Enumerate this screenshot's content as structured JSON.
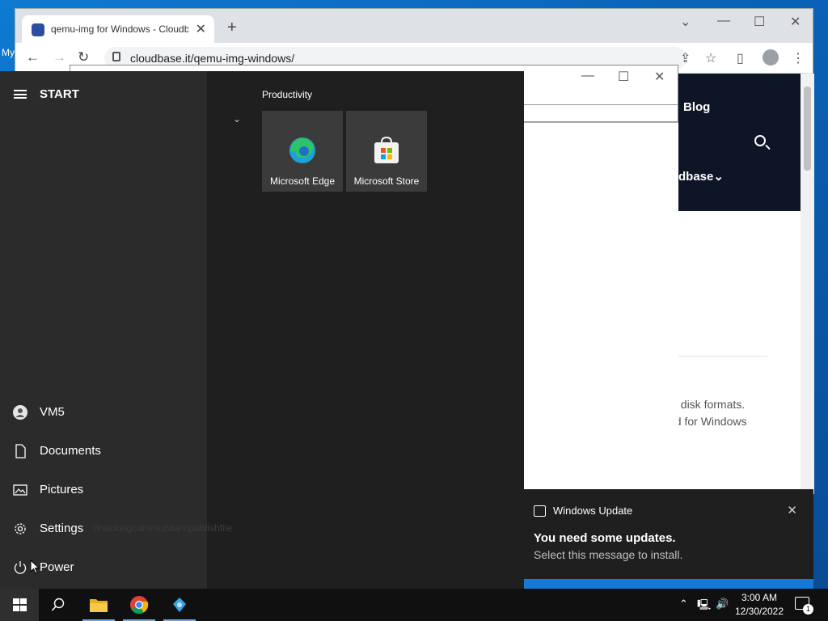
{
  "desktop": {
    "label": "My"
  },
  "browser": {
    "tab_title": "qemu-img for Windows - Cloudbase Solutions",
    "tab_close": "✕",
    "new_tab": "+",
    "url": "cloudbase.it/qemu-img-windows/",
    "page": {
      "nav_blog": "Blog",
      "nav_menu": "dbase⌄",
      "text_line1": "al disk formats.",
      "text_line2": "ed for Windows"
    }
  },
  "start_menu": {
    "title": "START",
    "group_title": "Productivity",
    "tiles": [
      {
        "label": "Microsoft Edge",
        "icon": "edge-icon"
      },
      {
        "label": "Microsoft Store",
        "icon": "store-icon"
      }
    ],
    "items": [
      {
        "label": "VM5",
        "icon": "user-icon"
      },
      {
        "label": "Documents",
        "icon": "document-icon"
      },
      {
        "label": "Pictures",
        "icon": "pictures-icon"
      },
      {
        "label": "Settings",
        "icon": "gear-icon"
      },
      {
        "label": "Power",
        "icon": "power-icon"
      }
    ],
    "ghost_text": "\\\\hackingcommunities\\publishfile"
  },
  "notification": {
    "app_name": "Windows Update",
    "title": "You need some updates.",
    "body": "Select this message to install.",
    "close": "✕"
  },
  "taskbar": {
    "time": "3:00 AM",
    "date": "12/30/2022",
    "notification_count": "1",
    "apps": [
      "search-icon",
      "file-explorer-icon",
      "chrome-icon",
      "app-icon"
    ]
  },
  "colors": {
    "accent": "#1779d6",
    "start_bg": "#1f1f1f",
    "taskbar_bg": "#101010"
  }
}
